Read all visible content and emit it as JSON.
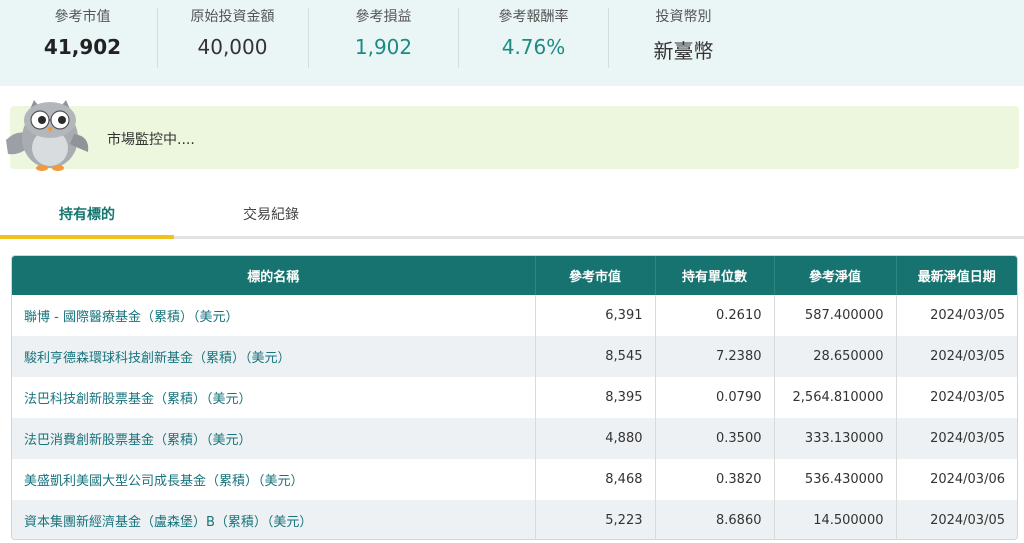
{
  "summary": {
    "market_value": {
      "label": "參考市值",
      "value": "41,902"
    },
    "original_investment": {
      "label": "原始投資金額",
      "value": "40,000"
    },
    "gain_loss": {
      "label": "參考損益",
      "value": "1,902"
    },
    "return_rate": {
      "label": "參考報酬率",
      "value": "4.76%"
    },
    "currency": {
      "label": "投資幣別",
      "value": "新臺幣"
    }
  },
  "banner": {
    "message": "市場監控中...."
  },
  "tabs": [
    {
      "label": "持有標的",
      "active": true
    },
    {
      "label": "交易紀錄",
      "active": false
    }
  ],
  "table": {
    "headers": [
      "標的名稱",
      "參考市值",
      "持有單位數",
      "參考淨值",
      "最新淨值日期"
    ],
    "rows": [
      {
        "name": "聯博 - 國際醫療基金（累積）（美元）",
        "market_value": "6,391",
        "units": "0.2610",
        "nav": "587.400000",
        "nav_date": "2024/03/05"
      },
      {
        "name": "駿利亨德森環球科技創新基金（累積）（美元）",
        "market_value": "8,545",
        "units": "7.2380",
        "nav": "28.650000",
        "nav_date": "2024/03/05"
      },
      {
        "name": "法巴科技創新股票基金（累積）（美元）",
        "market_value": "8,395",
        "units": "0.0790",
        "nav": "2,564.810000",
        "nav_date": "2024/03/05"
      },
      {
        "name": "法巴消費創新股票基金（累積）（美元）",
        "market_value": "4,880",
        "units": "0.3500",
        "nav": "333.130000",
        "nav_date": "2024/03/05"
      },
      {
        "name": "美盛凱利美國大型公司成長基金（累積）（美元）",
        "market_value": "8,468",
        "units": "0.3820",
        "nav": "536.430000",
        "nav_date": "2024/03/06"
      },
      {
        "name": "資本集團新經濟基金（盧森堡）B（累積）（美元）",
        "market_value": "5,223",
        "units": "8.6860",
        "nav": "14.500000",
        "nav_date": "2024/03/05"
      }
    ]
  },
  "colors": {
    "summary_bg": "#eaf6f5",
    "teal": "#1e8a84",
    "header_bg": "#16736f",
    "banner_bg": "#ecf7dd",
    "tab_active_bar": "#f1c21b"
  },
  "icons": {
    "mascot": "owl-mascot-icon"
  }
}
